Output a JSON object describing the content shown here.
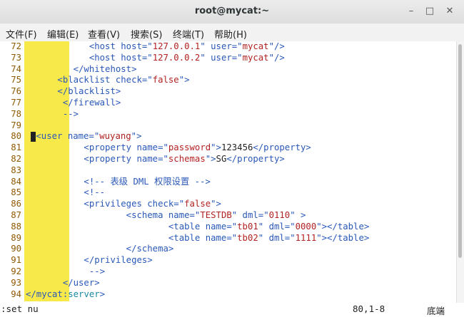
{
  "window": {
    "title": "root@mycat:~",
    "controls": [
      "–",
      "□",
      "✕"
    ]
  },
  "menu": [
    "文件(F)",
    "编辑(E)",
    "查看(V)",
    "搜索(S)",
    "终端(T)",
    "帮助(H)"
  ],
  "lines": [
    {
      "n": "72",
      "text": "            <host host=\"127.0.0.1\" user=\"mycat\"/>"
    },
    {
      "n": "73",
      "text": "            <host host=\"127.0.0.2\" user=\"mycat\"/>"
    },
    {
      "n": "74",
      "text": "         </whitehost>"
    },
    {
      "n": "75",
      "text": "      <blacklist check=\"false\">"
    },
    {
      "n": "76",
      "text": "      </blacklist>"
    },
    {
      "n": "77",
      "text": "       </firewall>"
    },
    {
      "n": "78",
      "text": "       -->"
    },
    {
      "n": "79",
      "text": ""
    },
    {
      "n": "80",
      "text": "  <user name=\"wuyang\">"
    },
    {
      "n": "81",
      "text": "           <property name=\"password\">123456</property>"
    },
    {
      "n": "82",
      "text": "           <property name=\"schemas\">SG</property>"
    },
    {
      "n": "83",
      "text": ""
    },
    {
      "n": "84",
      "text": "           <!-- 表级 DML 权限设置 -->"
    },
    {
      "n": "85",
      "text": "           <!--"
    },
    {
      "n": "86",
      "text": "           <privileges check=\"false\">"
    },
    {
      "n": "87",
      "text": "                   <schema name=\"TESTDB\" dml=\"0110\" >"
    },
    {
      "n": "88",
      "text": "                           <table name=\"tb01\" dml=\"0000\"></table>"
    },
    {
      "n": "89",
      "text": "                           <table name=\"tb02\" dml=\"1111\"></table>"
    },
    {
      "n": "90",
      "text": "                   </schema>"
    },
    {
      "n": "91",
      "text": "           </privileges>"
    },
    {
      "n": "92",
      "text": "            -->"
    },
    {
      "n": "93",
      "text": "       </user>"
    },
    {
      "n": "94",
      "text": "</mycat:server>"
    }
  ],
  "status": {
    "command": ":set nu",
    "position": "80,1-8",
    "where": "底端"
  },
  "colors": {
    "line_number": "#8f5902",
    "tag": "#2a58b8",
    "value": "#b22222",
    "highlight": "#f8e94b"
  }
}
